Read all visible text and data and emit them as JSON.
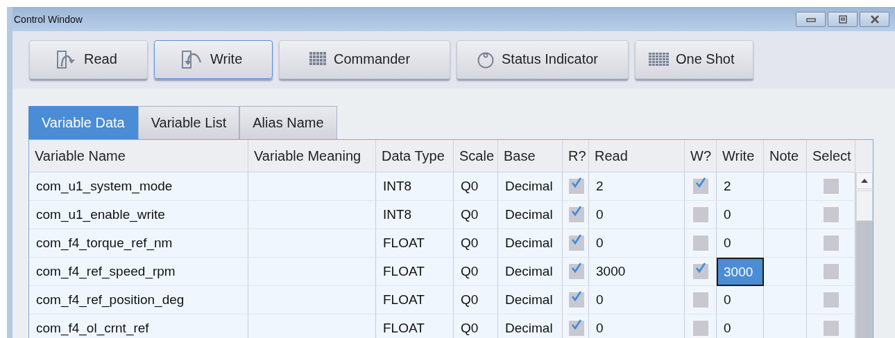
{
  "window": {
    "title": "Control Window"
  },
  "toolbar": [
    {
      "label": "Read",
      "selected": false
    },
    {
      "label": "Write",
      "selected": true
    },
    {
      "label": "Commander",
      "selected": false
    },
    {
      "label": "Status Indicator",
      "selected": false
    },
    {
      "label": "One Shot",
      "selected": false
    }
  ],
  "tabs": [
    {
      "label": "Variable Data",
      "selected": true
    },
    {
      "label": "Variable List",
      "selected": false
    },
    {
      "label": "Alias Name",
      "selected": false
    }
  ],
  "table": {
    "columns": [
      "Variable Name",
      "Variable Meaning",
      "Data Type",
      "Scale",
      "Base",
      "R?",
      "Read",
      "W?",
      "Write",
      "Note",
      "Select"
    ],
    "rows": [
      {
        "name": "com_u1_system_mode",
        "type": "INT8",
        "scale": "Q0",
        "base": "Decimal",
        "read_checked": true,
        "read": "2",
        "write_checked": true,
        "write": "2",
        "write_selected": false,
        "select_checked": false
      },
      {
        "name": "com_u1_enable_write",
        "type": "INT8",
        "scale": "Q0",
        "base": "Decimal",
        "read_checked": true,
        "read": "0",
        "write_checked": false,
        "write": "0",
        "write_selected": false,
        "select_checked": false
      },
      {
        "name": "com_f4_torque_ref_nm",
        "type": "FLOAT",
        "scale": "Q0",
        "base": "Decimal",
        "read_checked": true,
        "read": "0",
        "write_checked": false,
        "write": "0",
        "write_selected": false,
        "select_checked": false
      },
      {
        "name": "com_f4_ref_speed_rpm",
        "type": "FLOAT",
        "scale": "Q0",
        "base": "Decimal",
        "read_checked": true,
        "read": "3000",
        "write_checked": true,
        "write": "3000",
        "write_selected": true,
        "select_checked": false
      },
      {
        "name": "com_f4_ref_position_deg",
        "type": "FLOAT",
        "scale": "Q0",
        "base": "Decimal",
        "read_checked": true,
        "read": "0",
        "write_checked": false,
        "write": "0",
        "write_selected": false,
        "select_checked": false
      },
      {
        "name": "com_f4_ol_crnt_ref",
        "type": "FLOAT",
        "scale": "Q0",
        "base": "Decimal",
        "read_checked": true,
        "read": "0",
        "write_checked": false,
        "write": "0",
        "write_selected": false,
        "select_checked": false
      }
    ]
  }
}
